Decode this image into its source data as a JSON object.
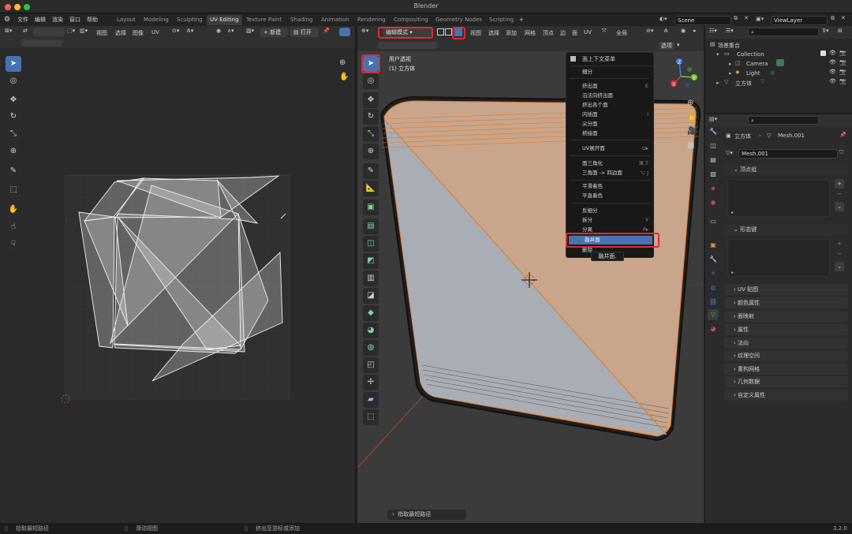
{
  "window": {
    "title": "Blender"
  },
  "menubar": {
    "items": [
      "文件",
      "编辑",
      "渲染",
      "窗口",
      "帮助"
    ]
  },
  "workspaces": [
    "Layout",
    "Modeling",
    "Sculpting",
    "UV Editing",
    "Texture Paint",
    "Shading",
    "Animation",
    "Rendering",
    "Compositing",
    "Geometry Nodes",
    "Scripting"
  ],
  "active_workspace": "UV Editing",
  "add_workspace": "+",
  "scene": {
    "name": "Scene"
  },
  "viewlayer": {
    "name": "ViewLayer"
  },
  "uv_editor": {
    "menu": [
      "视图",
      "选择",
      "图像",
      "UV"
    ],
    "new_label": "新建",
    "open_label": "打开"
  },
  "viewport": {
    "mode": "编辑模式",
    "menu": [
      "视图",
      "选择",
      "添加",
      "网格",
      "顶点",
      "边",
      "面",
      "UV"
    ],
    "transform": "全局",
    "options": "选项",
    "overlay_text1": "用户透视",
    "overlay_text2": "(1) 立方体",
    "bottom_hint": "指取最短路径",
    "axes": {
      "x": "X",
      "y": "Y",
      "z": "Z"
    }
  },
  "context_menu": {
    "title": "面上下文菜单",
    "items": [
      {
        "label": "细分",
        "shortcut": ""
      },
      {
        "label": "挤出面",
        "shortcut": "E"
      },
      {
        "label": "沿法向挤出面",
        "shortcut": ""
      },
      {
        "label": "挤出各个面",
        "shortcut": ""
      },
      {
        "label": "内插面",
        "shortcut": "I"
      },
      {
        "label": "尖分面",
        "shortcut": ""
      },
      {
        "label": "桥接面",
        "shortcut": ""
      },
      {
        "label": "UV展开面",
        "shortcut": "U▸"
      },
      {
        "label": "面三角化",
        "shortcut": "⌘ T"
      },
      {
        "label": "三角面 -> 四边面",
        "shortcut": "⌥ J"
      },
      {
        "label": "平滑着色",
        "shortcut": ""
      },
      {
        "label": "平直着色",
        "shortcut": ""
      },
      {
        "label": "反细分",
        "shortcut": ""
      },
      {
        "label": "拆分",
        "shortcut": "Y"
      },
      {
        "label": "分离",
        "shortcut": "P▸"
      },
      {
        "label": "融并面",
        "shortcut": ""
      },
      {
        "label": "删除",
        "shortcut": ""
      }
    ],
    "tooltip": "融并面."
  },
  "outliner": {
    "root": "场景集合",
    "collection": "Collection",
    "items": [
      "Camera",
      "Light",
      "立方体"
    ]
  },
  "properties": {
    "breadcrumb_object": "立方体",
    "breadcrumb_mesh": "Mesh.001",
    "mesh_name": "Mesh.001",
    "vertex_groups": "顶点组",
    "shape_keys": "形态键",
    "panels": [
      "UV 贴图",
      "颜色属性",
      "面映射",
      "属性",
      "法向",
      "纹理空间",
      "重构网格",
      "几何数据",
      "自定义属性"
    ]
  },
  "status": {
    "left": "拾取最短路径",
    "middle": "滑动视图",
    "right": "挤出至游标或添加",
    "version": "3.2.0"
  },
  "colors": {
    "accent": "#4772b3",
    "highlight": "#e12a2a",
    "mesh_fill": "#c9a58c",
    "mesh_edge": "#e07a2c"
  }
}
